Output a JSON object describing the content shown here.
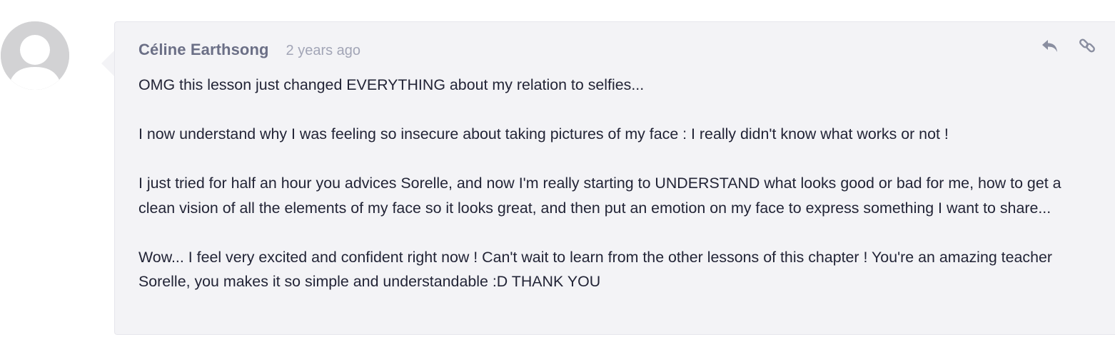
{
  "comment": {
    "author": "Céline Earthsong",
    "timestamp": "2 years ago",
    "paragraphs": [
      "OMG this lesson just changed EVERYTHING about my relation to selfies...",
      "I now understand why I was feeling so insecure about taking pictures of my face : I really didn't know what works or not !",
      "I just tried for half an hour you advices Sorelle, and now I'm really starting to UNDERSTAND what looks good or bad for me, how to get a clean vision of all the elements of my face so it looks great, and then put an emotion on my face to express something I want to share...",
      "Wow... I feel very excited and confident right now ! Can't wait to learn from the other lessons of this chapter ! You're an amazing teacher Sorelle, you makes it so simple and understandable :D THANK YOU"
    ],
    "actions": [
      {
        "icon": "reply-icon"
      },
      {
        "icon": "link-icon"
      }
    ],
    "avatar_icon": "default-user-avatar-icon"
  },
  "colors": {
    "bubble_background": "#f3f3f6",
    "author": "#6b6f86",
    "timestamp": "#a2a5b6",
    "text": "#222436",
    "icon": "#8a8ea0",
    "avatar": "#d2d2d4"
  }
}
